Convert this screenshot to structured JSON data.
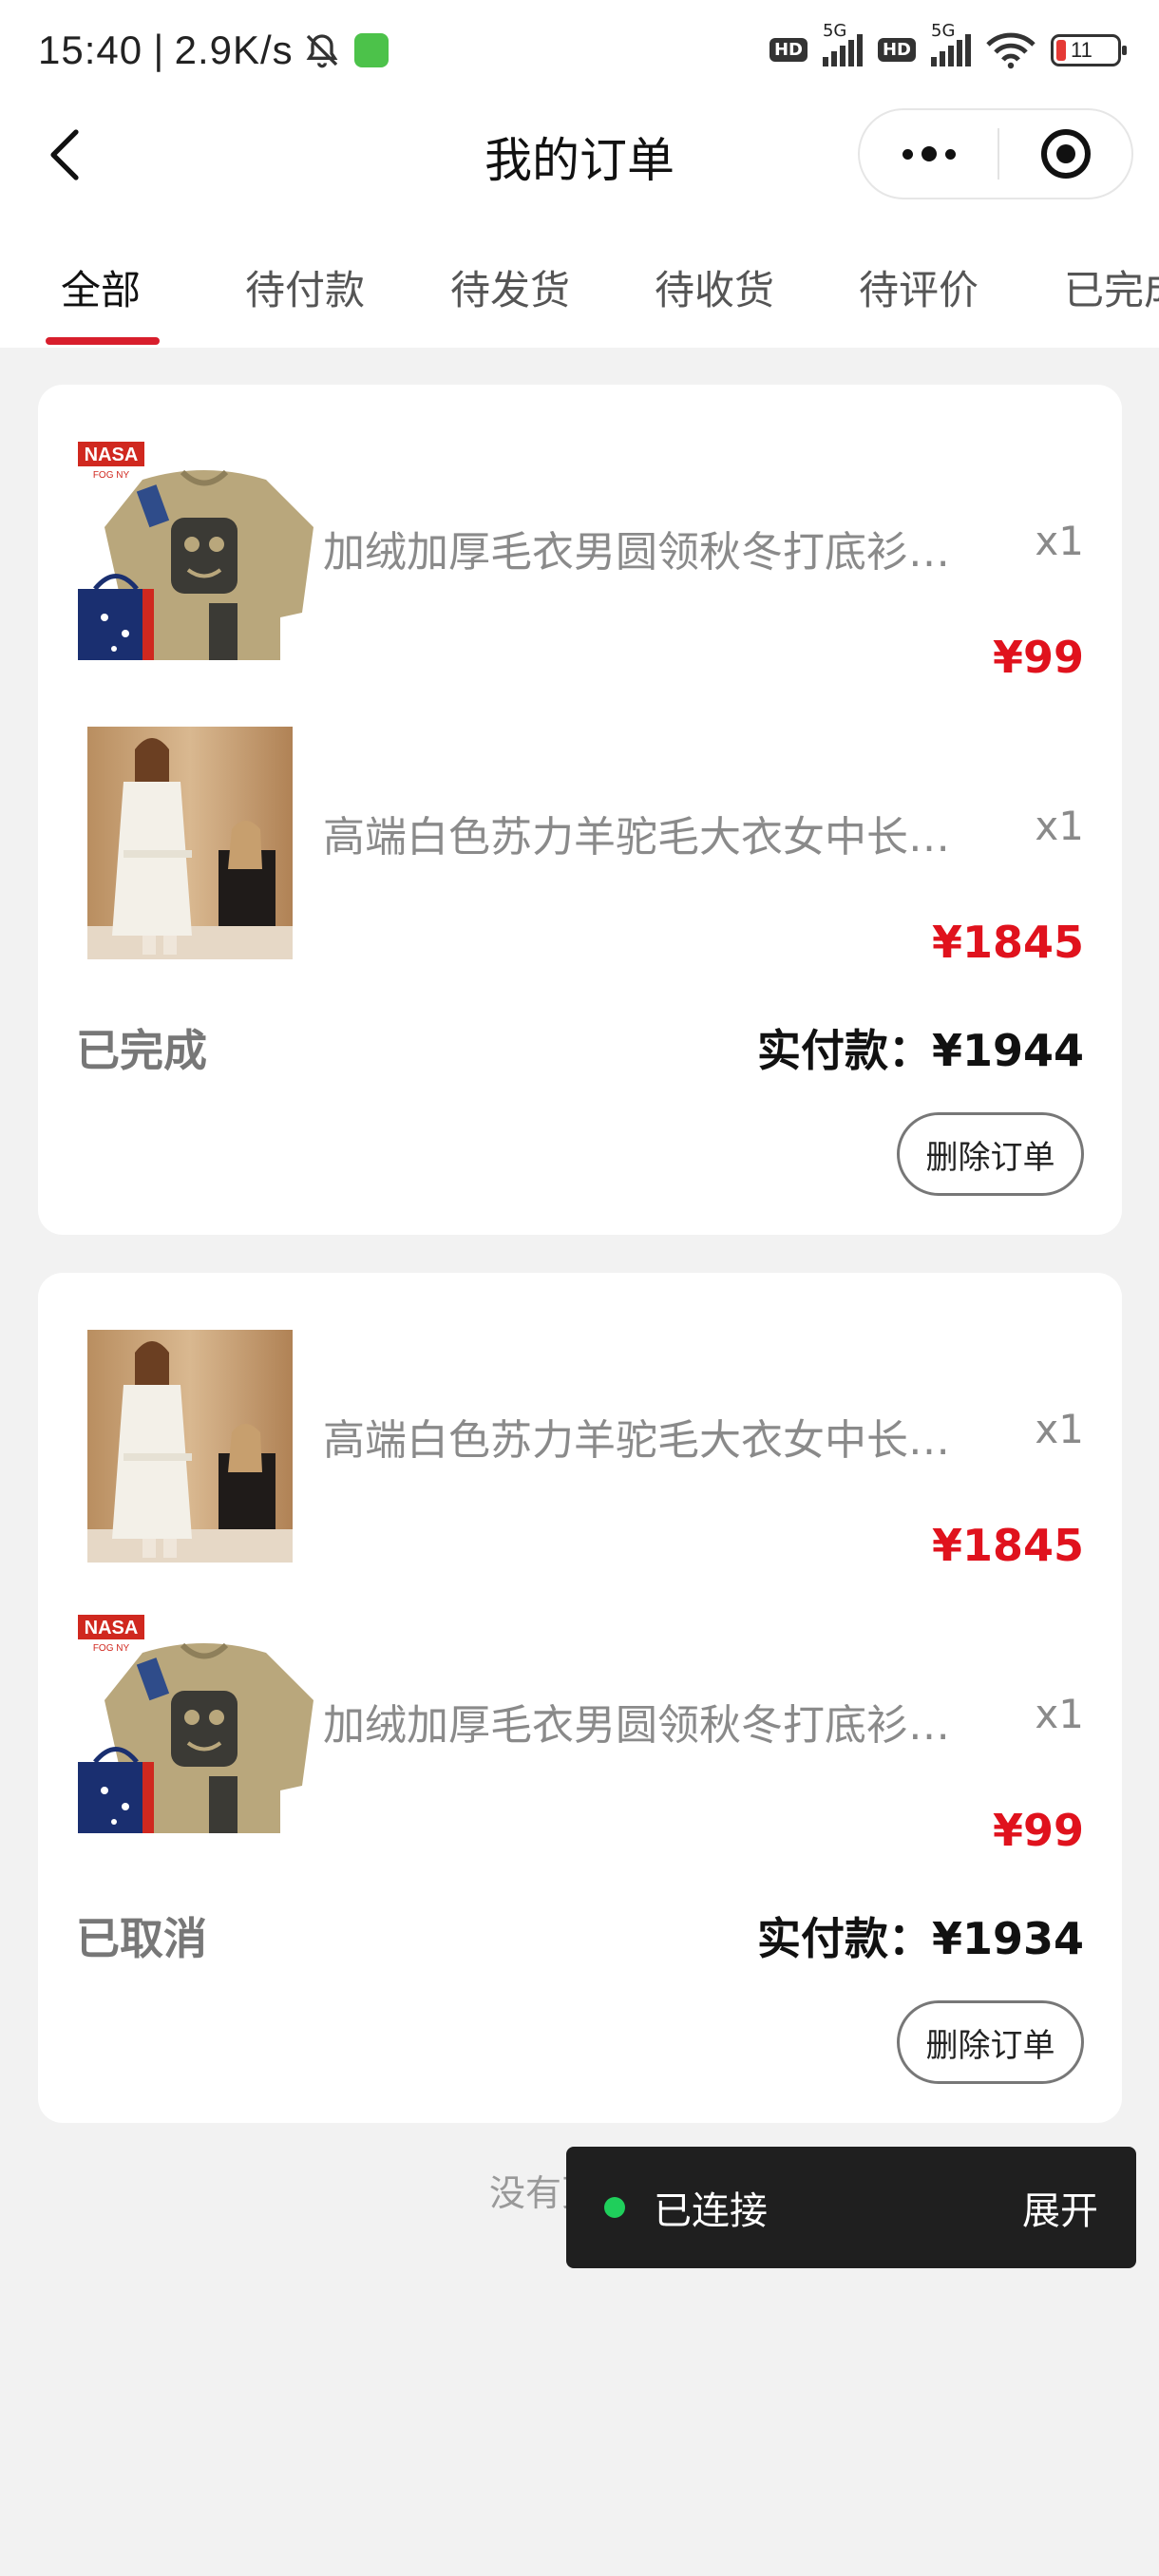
{
  "status_bar": {
    "time": "15:40",
    "net_speed": "2.9K/s",
    "signal_label_1": "5G",
    "signal_label_2": "5G",
    "hd_1": "HD",
    "hd_2": "HD",
    "battery": "11"
  },
  "nav": {
    "title": "我的订单"
  },
  "tabs": [
    {
      "label": "全部"
    },
    {
      "label": "待付款"
    },
    {
      "label": "待发货"
    },
    {
      "label": "待收货"
    },
    {
      "label": "待评价"
    },
    {
      "label": "已完成"
    }
  ],
  "orders": [
    {
      "items": [
        {
          "title": "加绒加厚毛衣男圆领秋冬打底衫…",
          "qty": "x1",
          "price": "¥99",
          "image": "sweater"
        },
        {
          "title": "高端白色苏力羊驼毛大衣女中长…",
          "qty": "x1",
          "price": "¥1845",
          "image": "coat"
        }
      ],
      "status": "已完成",
      "total": "实付款：¥1944",
      "action": "删除订单"
    },
    {
      "items": [
        {
          "title": "高端白色苏力羊驼毛大衣女中长…",
          "qty": "x1",
          "price": "¥1845",
          "image": "coat"
        },
        {
          "title": "加绒加厚毛衣男圆领秋冬打底衫…",
          "qty": "x1",
          "price": "¥99",
          "image": "sweater"
        }
      ],
      "status": "已取消",
      "total": "实付款：¥1934",
      "action": "删除订单"
    }
  ],
  "footer": {
    "no_more": "没有更多了"
  },
  "toast": {
    "message": "已连接",
    "expand": "展开"
  },
  "colors": {
    "accent": "#d81e2c",
    "price": "#e0121d",
    "toast_dot": "#1fcf5b"
  },
  "images": {
    "sweater": {
      "brand": "NASA",
      "sub": "FOG NY"
    }
  }
}
